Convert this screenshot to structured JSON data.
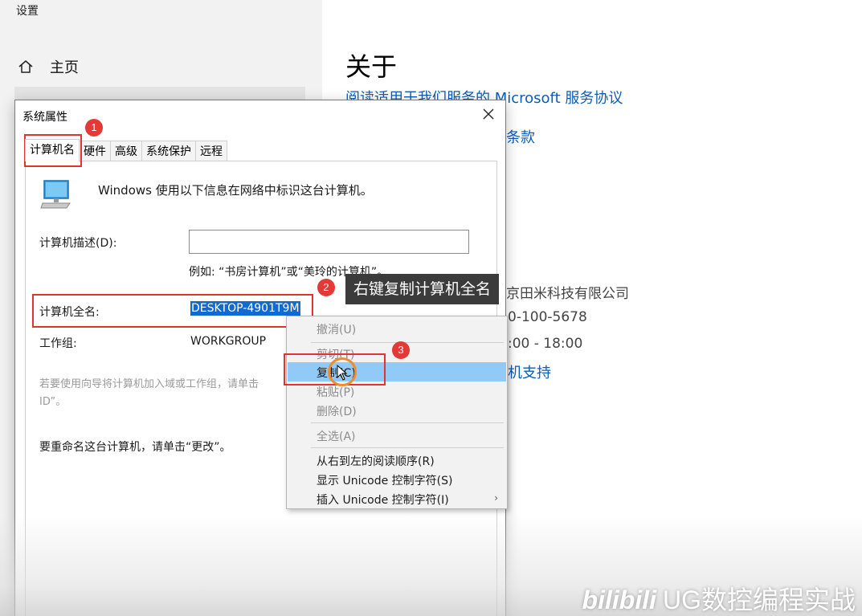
{
  "settings": {
    "app_title": "设置",
    "home_label": "主页",
    "about_title": "关于",
    "links": {
      "service_agreement": "阅读适用于我们服务的 Microsoft 服务协议",
      "terms_partial": "条款",
      "support_partial": "机支持"
    },
    "info": {
      "company_partial": "京田米科技有限公司",
      "phone_partial": "0-100-5678",
      "hours_partial": ":00 - 18:00"
    }
  },
  "dialog": {
    "title": "系统属性",
    "tabs": [
      "计算机名",
      "硬件",
      "高级",
      "系统保护",
      "远程"
    ],
    "active_tab": "计算机名",
    "intro": "Windows 使用以下信息在网络中标识这台计算机。",
    "description_label": "计算机描述(D):",
    "description_value": "",
    "example_text": "例如: “书房计算机”或“美玲的计算机”。",
    "fullname_label": "计算机全名:",
    "fullname_value": "DESKTOP-4901T9M",
    "workgroup_label": "工作组:",
    "workgroup_value": "WORKGROUP",
    "wizard_text_line1": "若要使用向导将计算机加入域或工作组，请单击",
    "wizard_text_line2": "ID”。",
    "rename_text": "要重命名这台计算机，请单击“更改”。"
  },
  "context_menu": {
    "items": [
      {
        "label": "撤消(U)",
        "disabled": true
      },
      {
        "label": "剪切(T)",
        "disabled": true
      },
      {
        "label": "复制(C)",
        "disabled": false,
        "highlighted": true
      },
      {
        "label": "粘贴(P)",
        "disabled": true
      },
      {
        "label": "删除(D)",
        "disabled": true
      },
      {
        "label": "全选(A)",
        "disabled": true
      },
      {
        "label": "从右到左的阅读顺序(R)",
        "disabled": false
      },
      {
        "label": "显示 Unicode 控制字符(S)",
        "disabled": false
      },
      {
        "label": "插入 Unicode 控制字符(I)",
        "disabled": false,
        "submenu": true
      }
    ]
  },
  "annotations": {
    "step1": "1",
    "step2": "2",
    "step3": "3",
    "tooltip": "右键复制计算机全名"
  },
  "watermark": {
    "logo": "bilibili",
    "text": "UG数控编程实战"
  },
  "colors": {
    "accent": "#0a5db8",
    "selection": "#0f6ad1",
    "menu_highlight": "#91c9f7",
    "annotation_red": "#e0352e"
  }
}
